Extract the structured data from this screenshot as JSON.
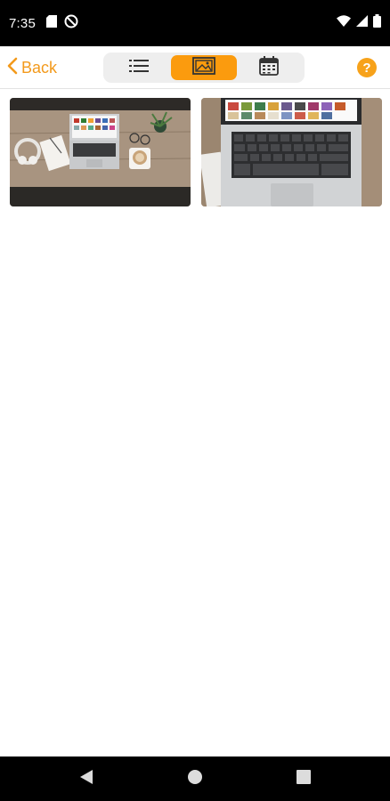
{
  "status_bar": {
    "time": "7:35",
    "left_icons": [
      "sim-card-icon",
      "no-disturb-icon"
    ],
    "right_icons": [
      "wifi-icon",
      "signal-icon",
      "battery-icon"
    ]
  },
  "app_bar": {
    "back_label": "Back",
    "view_tabs": [
      {
        "name": "list-view-icon",
        "active": false
      },
      {
        "name": "gallery-view-icon",
        "active": true
      },
      {
        "name": "calendar-view-icon",
        "active": false
      }
    ],
    "help_label": "?"
  },
  "gallery": {
    "images": [
      {
        "name": "photo-desk-laptop-overhead"
      },
      {
        "name": "photo-laptop-closeup"
      }
    ]
  },
  "nav_bar": {
    "buttons": [
      "back-nav-icon",
      "home-nav-icon",
      "recents-nav-icon"
    ]
  },
  "colors": {
    "accent": "#fb9b0e",
    "status_bar": "#000000"
  }
}
